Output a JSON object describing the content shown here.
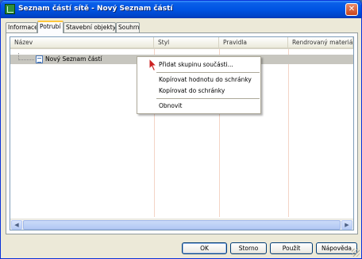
{
  "window": {
    "title": "Seznam částí sítě - Nový Seznam částí",
    "close_label": "✕"
  },
  "tabs": [
    {
      "label": "Informace",
      "active": false
    },
    {
      "label": "Potrubí",
      "active": true
    },
    {
      "label": "Stavební objekty",
      "active": false
    },
    {
      "label": "Souhrn",
      "active": false
    }
  ],
  "table": {
    "columns": [
      "Název",
      "Styl",
      "Pravidla",
      "Rendrovaný materiál"
    ],
    "tree_item": "Nový Seznam částí"
  },
  "context_menu": {
    "items": [
      {
        "label": "Přidat skupinu součásti..."
      },
      {
        "label": "Kopírovat hodnotu do schránky"
      },
      {
        "label": "Kopírovat do schránky"
      },
      {
        "label": "Obnovit"
      }
    ]
  },
  "buttons": {
    "ok": "OK",
    "cancel": "Storno",
    "apply": "Použít",
    "help": "Nápověda"
  },
  "scrollbar": {
    "left_arrow": "◀",
    "right_arrow": "▶"
  },
  "colors": {
    "titlebar": "#0054e3",
    "selected_row": "#c7c6bf",
    "active_tab_accent": "#ffc83c"
  },
  "icons": [
    "app-icon",
    "close-icon",
    "document-icon",
    "cursor-arrow-icon"
  ]
}
